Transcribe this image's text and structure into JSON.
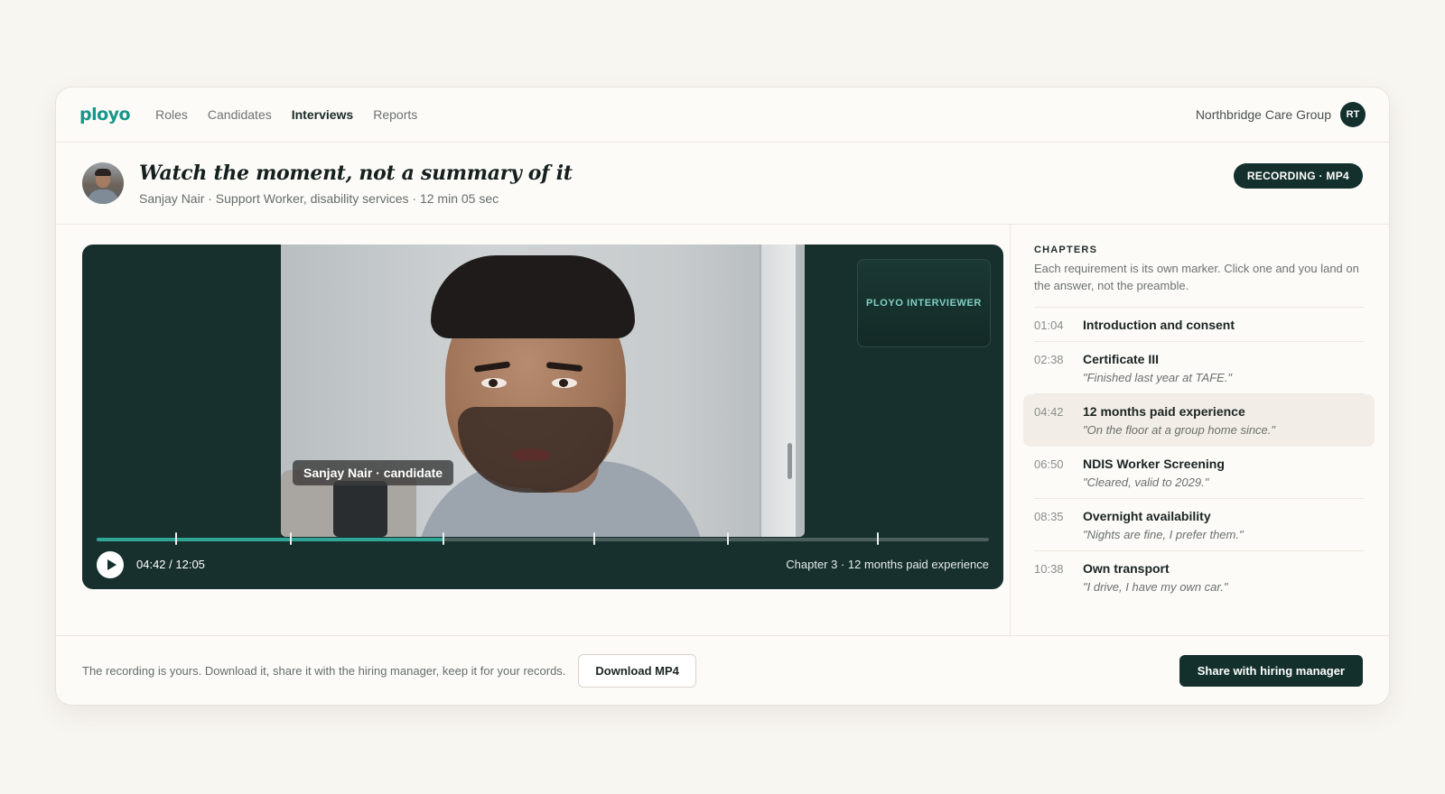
{
  "nav": {
    "logo": "ployo",
    "links": [
      {
        "label": "Roles",
        "active": false
      },
      {
        "label": "Candidates",
        "active": false
      },
      {
        "label": "Interviews",
        "active": true
      },
      {
        "label": "Reports",
        "active": false
      }
    ],
    "org_name": "Northbridge Care Group",
    "user_initials": "RT"
  },
  "header": {
    "title": "Watch the moment, not a summary of it",
    "subtitle": "Sanjay Nair · Support Worker, disability services · 12 min 05 sec",
    "badge": "RECORDING · MP4"
  },
  "player": {
    "candidate_tag": "Sanjay Nair · candidate",
    "interviewer_label": "PLOYO INTERVIEWER",
    "time_readout": "04:42 / 12:05",
    "chapter_readout": "Chapter 3 · 12 months paid experience",
    "progress_fraction": 0.39,
    "chapter_marker_fractions": [
      0.089,
      0.218,
      0.389,
      0.558,
      0.707,
      0.876
    ]
  },
  "chapters": {
    "heading": "CHAPTERS",
    "description": "Each requirement is its own marker. Click one and you land on the answer, not the preamble.",
    "items": [
      {
        "time": "01:04",
        "title": "Introduction and consent",
        "quote": ""
      },
      {
        "time": "02:38",
        "title": "Certificate III",
        "quote": "\"Finished last year at TAFE.\""
      },
      {
        "time": "04:42",
        "title": "12 months paid experience",
        "quote": "\"On the floor at a group home since.\"",
        "active": true
      },
      {
        "time": "06:50",
        "title": "NDIS Worker Screening",
        "quote": "\"Cleared, valid to 2029.\""
      },
      {
        "time": "08:35",
        "title": "Overnight availability",
        "quote": "\"Nights are fine, I prefer them.\""
      },
      {
        "time": "10:38",
        "title": "Own transport",
        "quote": "\"I drive, I have my own car.\""
      }
    ]
  },
  "footer": {
    "text": "The recording is yours. Download it, share it with the hiring manager, keep it for your records.",
    "download_label": "Download MP4",
    "share_label": "Share with hiring manager"
  },
  "colors": {
    "brand": "#17968a",
    "dark": "#13302d",
    "progress": "#2fa595"
  }
}
